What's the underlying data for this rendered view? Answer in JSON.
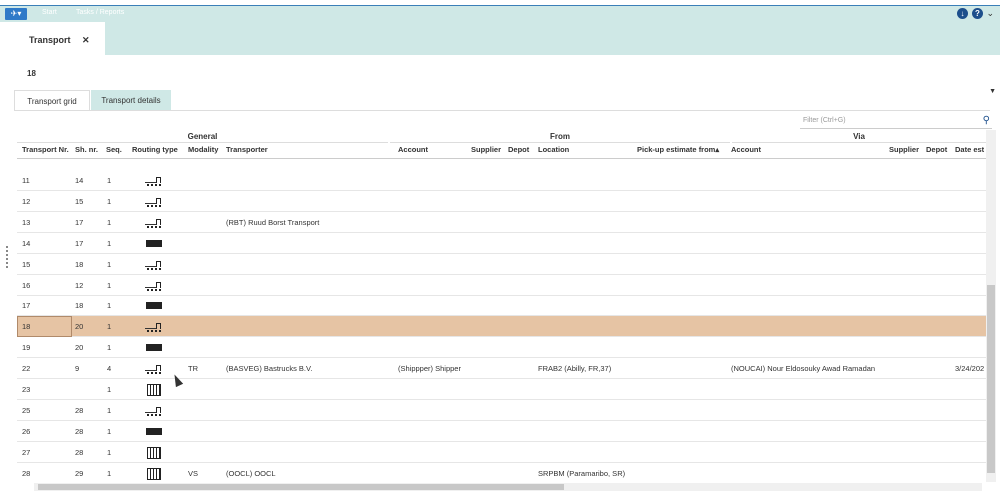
{
  "topbar": {
    "app_menu": "✈▾",
    "start": "Start",
    "tasks": "Tasks / Reports"
  },
  "doc_tab": {
    "title": "Transport",
    "close": "✕"
  },
  "record_number": "18",
  "subtabs": {
    "grid": "Transport grid",
    "details": "Transport details"
  },
  "filter": {
    "placeholder": "Filter (Ctrl+G)"
  },
  "groups": {
    "general": "General",
    "from": "From",
    "via": "Via"
  },
  "columns": {
    "transport_nr": "Transport Nr.",
    "sh_nr": "Sh. nr.",
    "seq": "Seq.",
    "routing_type": "Routing type",
    "modality": "Modality",
    "transporter": "Transporter",
    "account": "Account",
    "supplier": "Supplier",
    "depot": "Depot",
    "location": "Location",
    "pickup": "Pick-up estimate from▴",
    "via_account": "Account",
    "via_supplier": "Supplier",
    "via_depot": "Depot",
    "date_est": "Date est"
  },
  "rows": [
    {
      "tnr": "11",
      "sh": "14",
      "seq": "1",
      "icon": "trailer-truck-icon",
      "mod": "",
      "transporter": "",
      "account": "",
      "location": "",
      "via_account": "",
      "date": ""
    },
    {
      "tnr": "12",
      "sh": "15",
      "seq": "1",
      "icon": "trailer-truck-icon",
      "mod": "",
      "transporter": "",
      "account": "",
      "location": "",
      "via_account": "",
      "date": ""
    },
    {
      "tnr": "13",
      "sh": "17",
      "seq": "1",
      "icon": "trailer-truck-icon",
      "mod": "",
      "transporter": "(RBT) Ruud Borst Transport",
      "account": "",
      "location": "",
      "via_account": "",
      "date": ""
    },
    {
      "tnr": "14",
      "sh": "17",
      "seq": "1",
      "icon": "truck-icon",
      "mod": "",
      "transporter": "",
      "account": "",
      "location": "",
      "via_account": "",
      "date": ""
    },
    {
      "tnr": "15",
      "sh": "18",
      "seq": "1",
      "icon": "trailer-truck-icon",
      "mod": "",
      "transporter": "",
      "account": "",
      "location": "",
      "via_account": "",
      "date": ""
    },
    {
      "tnr": "16",
      "sh": "12",
      "seq": "1",
      "icon": "trailer-truck-icon",
      "mod": "",
      "transporter": "",
      "account": "",
      "location": "",
      "via_account": "",
      "date": ""
    },
    {
      "tnr": "17",
      "sh": "18",
      "seq": "1",
      "icon": "truck-icon",
      "mod": "",
      "transporter": "",
      "account": "",
      "location": "",
      "via_account": "",
      "date": ""
    },
    {
      "tnr": "18",
      "sh": "20",
      "seq": "1",
      "icon": "trailer-truck-icon",
      "mod": "",
      "transporter": "",
      "account": "",
      "location": "",
      "via_account": "",
      "date": ""
    },
    {
      "tnr": "19",
      "sh": "20",
      "seq": "1",
      "icon": "truck-icon",
      "mod": "",
      "transporter": "",
      "account": "",
      "location": "",
      "via_account": "",
      "date": ""
    },
    {
      "tnr": "22",
      "sh": "9",
      "seq": "4",
      "icon": "trailer-truck-icon",
      "mod": "TR",
      "transporter": "(BASVEG) Bastrucks B.V.",
      "account": "(Shippper) Shipper",
      "location": "FRAB2 (Abilly, FR,37)",
      "via_account": "(NOUCAI) Nour Eldosouky Awad Ramadan",
      "date": "3/24/202"
    },
    {
      "tnr": "23",
      "sh": "",
      "seq": "1",
      "icon": "container-icon",
      "mod": "",
      "transporter": "",
      "account": "",
      "location": "",
      "via_account": "",
      "date": ""
    },
    {
      "tnr": "25",
      "sh": "28",
      "seq": "1",
      "icon": "trailer-truck-icon",
      "mod": "",
      "transporter": "",
      "account": "",
      "location": "",
      "via_account": "",
      "date": ""
    },
    {
      "tnr": "26",
      "sh": "28",
      "seq": "1",
      "icon": "truck-icon",
      "mod": "",
      "transporter": "",
      "account": "",
      "location": "",
      "via_account": "",
      "date": ""
    },
    {
      "tnr": "27",
      "sh": "28",
      "seq": "1",
      "icon": "container-icon",
      "mod": "",
      "transporter": "",
      "account": "",
      "location": "",
      "via_account": "",
      "date": ""
    },
    {
      "tnr": "28",
      "sh": "29",
      "seq": "1",
      "icon": "container-icon",
      "mod": "VS",
      "transporter": "(OOCL) OOCL",
      "account": "",
      "location": "SRPBM (Paramaribo, SR)",
      "via_account": "",
      "date": ""
    }
  ],
  "selected_row": "18",
  "colors": {
    "accent": "#cfe8e6",
    "selected": "#e6c4a4",
    "brand": "#2f7ac8"
  }
}
